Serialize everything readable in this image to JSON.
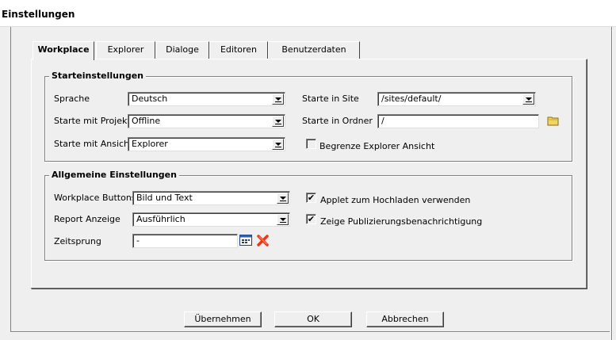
{
  "dialog": {
    "title": "Einstellungen"
  },
  "tabs": [
    {
      "label": "Workplace",
      "active": true
    },
    {
      "label": "Explorer",
      "active": false
    },
    {
      "label": "Dialoge",
      "active": false
    },
    {
      "label": "Editoren",
      "active": false
    },
    {
      "label": "Benutzerdaten",
      "active": false
    }
  ],
  "start_settings": {
    "legend": "Starteinstellungen",
    "language_label": "Sprache",
    "language_value": "Deutsch",
    "project_label": "Starte mit Projekt",
    "project_value": "Offline",
    "view_label": "Starte mit Ansicht",
    "view_value": "Explorer",
    "site_label": "Starte in Site",
    "site_value": "/sites/default/",
    "folder_label": "Starte in Ordner",
    "folder_value": "/",
    "limit_explorer_label": "Begrenze Explorer Ansicht",
    "limit_explorer_checked": false
  },
  "general_settings": {
    "legend": "Allgemeine Einstellungen",
    "buttons_label": "Workplace Buttons",
    "buttons_value": "Bild und Text",
    "report_label": "Report Anzeige",
    "report_value": "Ausführlich",
    "timewarp_label": "Zeitsprung",
    "timewarp_value": "-",
    "applet_label": "Applet zum Hochladen verwenden",
    "applet_checked": true,
    "publish_notify_label": "Zeige Publizierungsbenachrichtigung",
    "publish_notify_checked": true
  },
  "buttons": {
    "apply": "Übernehmen",
    "ok": "OK",
    "cancel": "Abbrechen"
  },
  "icons": {
    "folder": "folder-icon",
    "calendar": "calendar-icon",
    "clear": "clear-x-icon"
  },
  "colors": {
    "background": "#efefef",
    "folder": "#e8c53a",
    "clear": "#e03c1c"
  }
}
